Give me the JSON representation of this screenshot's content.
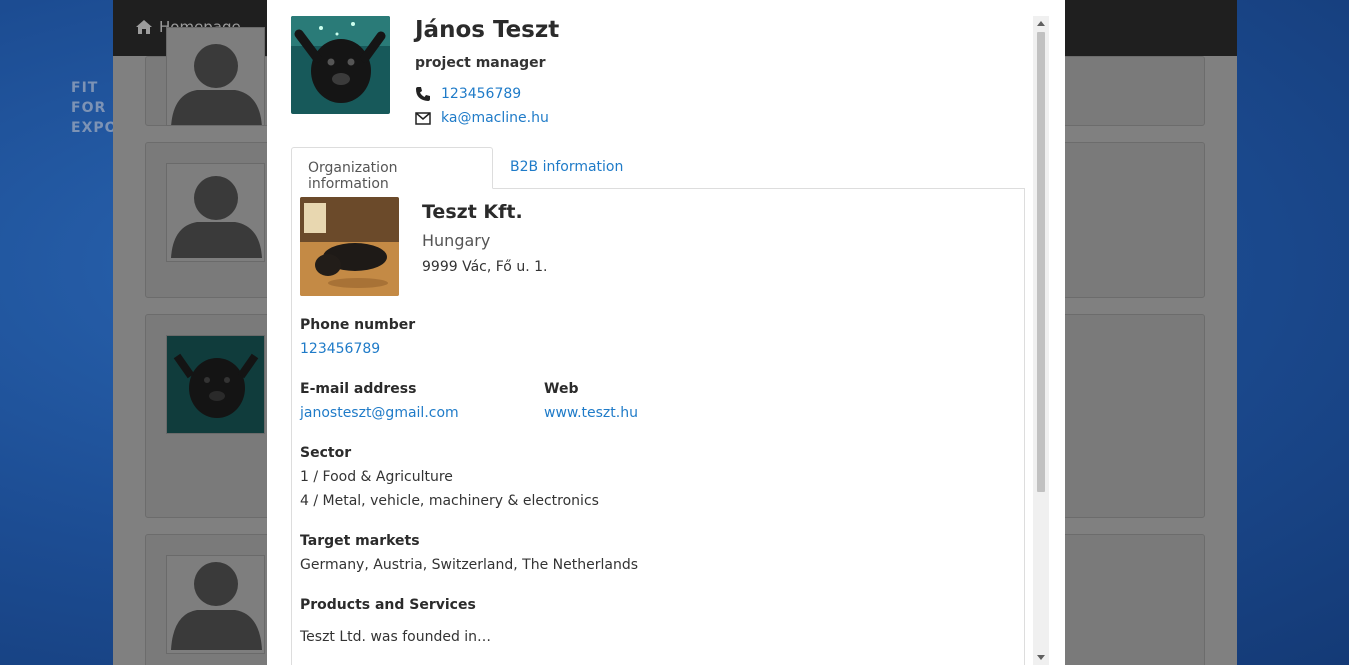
{
  "brand": {
    "lines": [
      "FIT",
      "FOR",
      "EXPORT"
    ]
  },
  "navbar": {
    "home_label": "Homepage",
    "home_icon": "home-icon"
  },
  "person": {
    "name": "János Teszt",
    "title": "project manager",
    "phone": "123456789",
    "email": "ka@macline.hu",
    "phone_icon": "phone-icon",
    "email_icon": "envelope-icon"
  },
  "tabs": [
    {
      "label": "Organization information",
      "active": true
    },
    {
      "label": "B2B information",
      "active": false
    }
  ],
  "organization": {
    "name": "Teszt Kft.",
    "country": "Hungary",
    "address": "9999 Vác, Fő u. 1.",
    "phone_label": "Phone number",
    "phone": "123456789",
    "email_label": "E-mail address",
    "email": "janosteszt@gmail.com",
    "web_label": "Web",
    "web": "www.teszt.hu",
    "sector_label": "Sector",
    "sectors": [
      "1 / Food & Agriculture",
      "4 / Metal, vehicle, machinery & electronics"
    ],
    "markets_label": "Target markets",
    "markets": "Germany, Austria, Switzerland, The Netherlands",
    "products_label": "Products and Services",
    "products": "Teszt Ltd. was founded in…"
  },
  "colors": {
    "link": "#1f7bc8",
    "navbar": "#1f1f1f",
    "overlay": "#808080",
    "background": "#1c4f97"
  }
}
